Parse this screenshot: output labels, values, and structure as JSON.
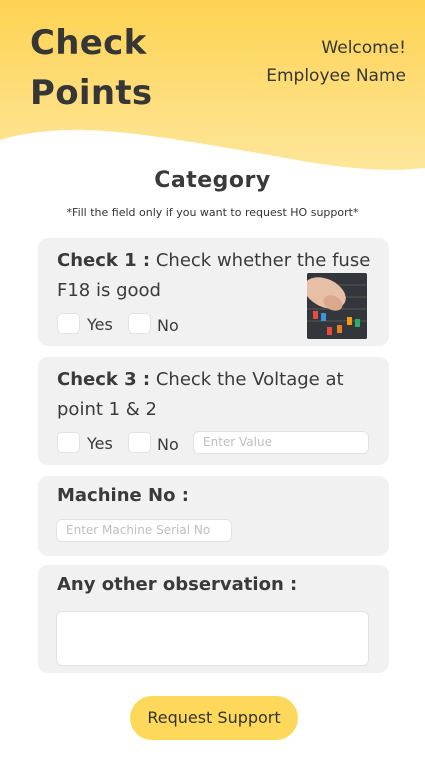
{
  "header": {
    "title_line1": "Check",
    "title_line2": "Points",
    "welcome": "Welcome!",
    "employee": "Employee Name"
  },
  "category": {
    "title": "Category",
    "hint": "*Fill the field only if you want to request HO support*"
  },
  "checks": [
    {
      "label": "Check 1 :",
      "text": " Check whether the fuse F18 is good",
      "yes_label": "Yes",
      "no_label": "No",
      "image_icon": "fuse-box-photo"
    },
    {
      "label": "Check 3 :",
      "text": " Check the Voltage at point 1 & 2",
      "yes_label": "Yes",
      "no_label": "No",
      "value_placeholder": "Enter Value"
    }
  ],
  "machine": {
    "label": "Machine No :",
    "placeholder": "Enter Machine Serial No"
  },
  "observation": {
    "label": "Any other observation :"
  },
  "submit_label": "Request Support",
  "colors": {
    "accent": "#fdd85a",
    "header_gradient_start": "#fdd352",
    "header_gradient_end": "#fee8a1",
    "card_bg": "#f1f1f1"
  }
}
